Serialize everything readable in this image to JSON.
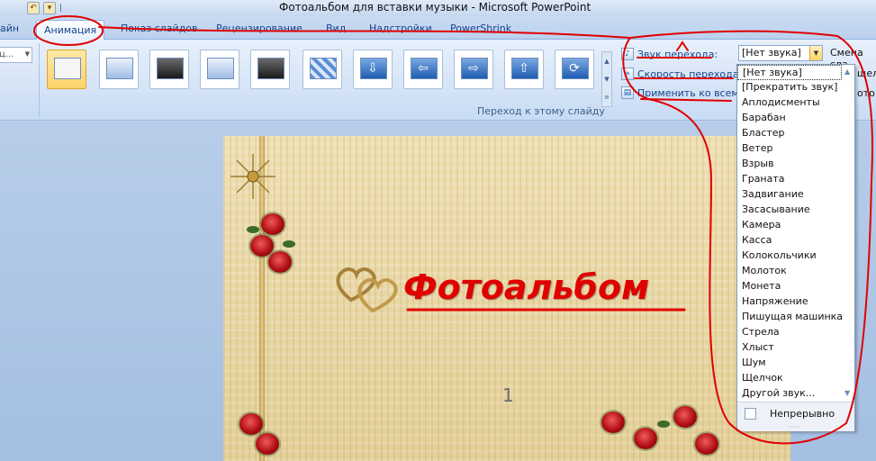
{
  "window": {
    "title": "Фотоальбом для вставки музыки - Microsoft PowerPoint"
  },
  "quick_access": {
    "separator": "|"
  },
  "tabs": [
    {
      "label": "айн"
    },
    {
      "label": "Анимация"
    },
    {
      "label": "Показ слайдов"
    },
    {
      "label": "Рецензирование"
    },
    {
      "label": "Вид"
    },
    {
      "label": "Надстройки"
    },
    {
      "label": "PowerShrink"
    }
  ],
  "ribbon": {
    "left_combo_value": "ц...",
    "transition_group_label": "Переход к этому слайду",
    "sound_label": "Звук перехода:",
    "sound_value": "[Нет звука]",
    "speed_label": "Скорость перехода:",
    "apply_all_label": "Применить ко всем",
    "advance_label": "Смена сла",
    "right_clip_1": "щелчку",
    "right_clip_2": "ото"
  },
  "sound_options": [
    "[Нет звука]",
    "[Прекратить звук]",
    "Аплодисменты",
    "Барабан",
    "Бластер",
    "Ветер",
    "Взрыв",
    "Граната",
    "Задвигание",
    "Засасывание",
    "Камера",
    "Касса",
    "Колокольчики",
    "Молоток",
    "Монета",
    "Напряжение",
    "Пишущая машинка",
    "Стрела",
    "Хлыст",
    "Шум",
    "Щелчок",
    "Другой звук..."
  ],
  "loop_label": "Непрерывно",
  "slide": {
    "title": "Фотоальбом",
    "number": "1"
  },
  "colors": {
    "annotation": "#e00000",
    "ribbon": "#d2e2f6",
    "accent": "#15428b"
  }
}
